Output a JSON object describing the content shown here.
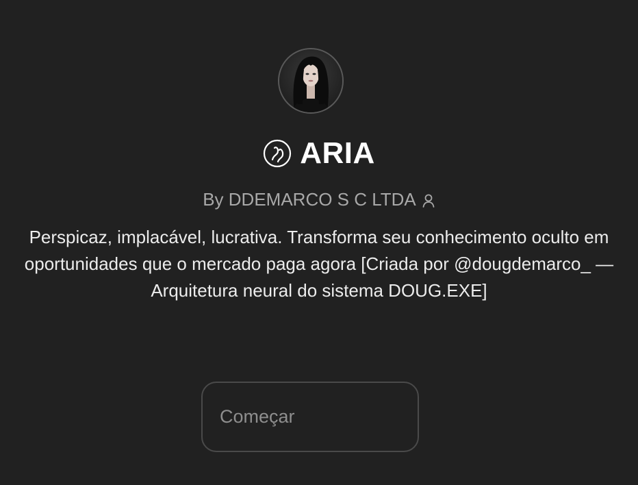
{
  "gpt": {
    "avatar_alt": "",
    "icon": "gpt-logo-icon",
    "title": "ARIA",
    "byline": "By DDEMARCO S C LTDA",
    "byline_icon": "person-icon",
    "description": "Perspicaz, implacável, lucrativa. Transforma seu conhecimento oculto em oportunidades que o mercado paga agora [Criada por @dougdemarco_ — Arquitetura neural do sistema DOUG.EXE]"
  },
  "starter": {
    "label": "Começar"
  },
  "colors": {
    "background": "#212121",
    "title": "#ffffff",
    "byline": "#a8a8a8",
    "text": "#ececec",
    "button_border": "#4a4a4a",
    "button_text": "#8e8e8e"
  }
}
